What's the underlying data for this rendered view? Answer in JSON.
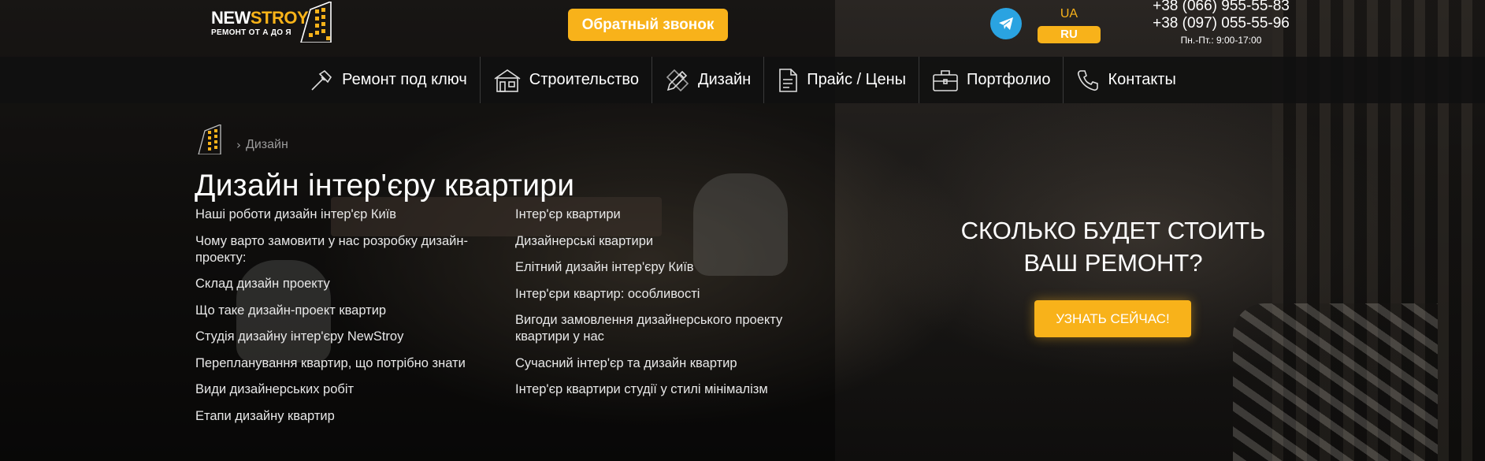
{
  "header": {
    "logo": {
      "word_main": "NEW",
      "word_accent": "STROY",
      "subtitle": "РЕМОНТ ОТ А ДО Я"
    },
    "callback_label": "Обратный звонок",
    "languages": {
      "ua": "UA",
      "ru": "RU",
      "active": "RU"
    },
    "phones": [
      "+38 (066) 955-55-83",
      "+38 (097) 055-55-96"
    ],
    "hours": "Пн.-Пт.: 9:00-17:00",
    "brand_color": "#f8b21a",
    "telegram_color": "#2aa3e1"
  },
  "nav": [
    {
      "label": "Ремонт под ключ",
      "icon": "hammer-icon"
    },
    {
      "label": "Строительство",
      "icon": "house-icon"
    },
    {
      "label": "Дизайн",
      "icon": "pencil-ruler-icon"
    },
    {
      "label": "Прайс / Цены",
      "icon": "document-icon"
    },
    {
      "label": "Портфолио",
      "icon": "briefcase-icon"
    },
    {
      "label": "Контакты",
      "icon": "phone-icon"
    }
  ],
  "breadcrumb": {
    "separator": "›",
    "current": "Дизайн"
  },
  "page_title": "Дизайн інтер'єру квартири",
  "toc_left": [
    "Наші роботи дизайн інтер'єр Київ",
    "Чому варто замовити у нас розробку дизайн-проекту:",
    "Склад дизайн проекту",
    "Що таке дизайн-проект квартир",
    "Студія дизайну інтер'єру NewStroy",
    "Перепланування квартир, що потрібно знати",
    "Види дизайнерських робіт",
    "Етапи дизайну квартир"
  ],
  "toc_right": [
    "Інтер'єр квартири",
    "Дизайнерські квартири",
    "Елітний дизайн інтер'єру Київ",
    "Інтер'єри квартир: особливості",
    "Вигоди замовлення дизайнерського проекту квартири у нас",
    "Сучасний інтер'єр та дизайн квартир",
    "Інтер'єр квартири студії у стилі мінімалізм"
  ],
  "cta": {
    "title_line1": "СКОЛЬКО БУДЕТ СТОИТЬ",
    "title_line2": "ВАШ РЕМОНТ?",
    "button": "УЗНАТЬ СЕЙЧАС!"
  }
}
